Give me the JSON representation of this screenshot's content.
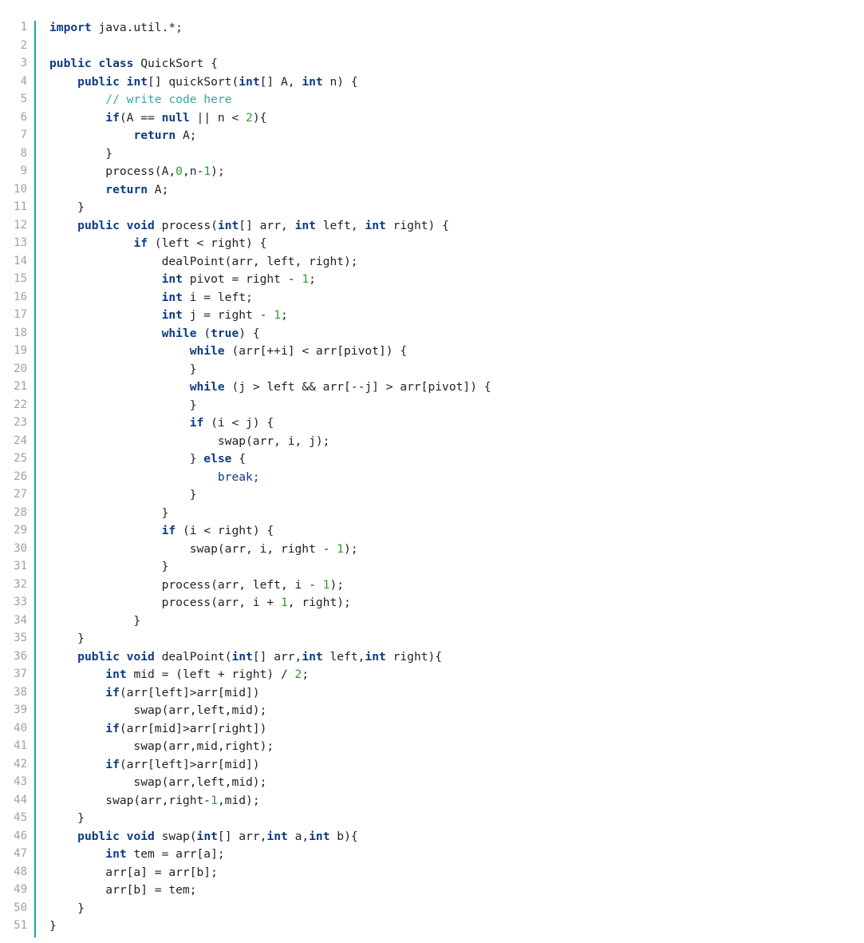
{
  "colors": {
    "keyword": "#0d3c84",
    "number": "#2e9a2e",
    "comment": "#35a89a",
    "gutter_border": "#1fa392",
    "line_number": "#a0a0a0"
  },
  "code_lines": [
    "import java.util.*;",
    "",
    "public class QuickSort {",
    "    public int[] quickSort(int[] A, int n) {",
    "        // write code here",
    "        if(A == null || n < 2){",
    "            return A;",
    "        }",
    "        process(A,0,n-1);",
    "        return A;",
    "    }",
    "    public void process(int[] arr, int left, int right) {",
    "            if (left < right) {",
    "                dealPoint(arr, left, right);",
    "                int pivot = right - 1;",
    "                int i = left;",
    "                int j = right - 1;",
    "                while (true) {",
    "                    while (arr[++i] < arr[pivot]) {",
    "                    }",
    "                    while (j > left && arr[--j] > arr[pivot]) {",
    "                    }",
    "                    if (i < j) {",
    "                        swap(arr, i, j);",
    "                    } else {",
    "                        break;",
    "                    }",
    "                }",
    "                if (i < right) {",
    "                    swap(arr, i, right - 1);",
    "                }",
    "                process(arr, left, i - 1);",
    "                process(arr, i + 1, right);",
    "            }",
    "    }",
    "    public void dealPoint(int[] arr,int left,int right){",
    "        int mid = (left + right) / 2;",
    "        if(arr[left]>arr[mid])",
    "            swap(arr,left,mid);",
    "        if(arr[mid]>arr[right])",
    "            swap(arr,mid,right);",
    "        if(arr[left]>arr[mid])",
    "            swap(arr,left,mid);",
    "        swap(arr,right-1,mid);",
    "    }",
    "    public void swap(int[] arr,int a,int b){",
    "        int tem = arr[a];",
    "        arr[a] = arr[b];",
    "        arr[b] = tem;",
    "    }",
    "}"
  ]
}
